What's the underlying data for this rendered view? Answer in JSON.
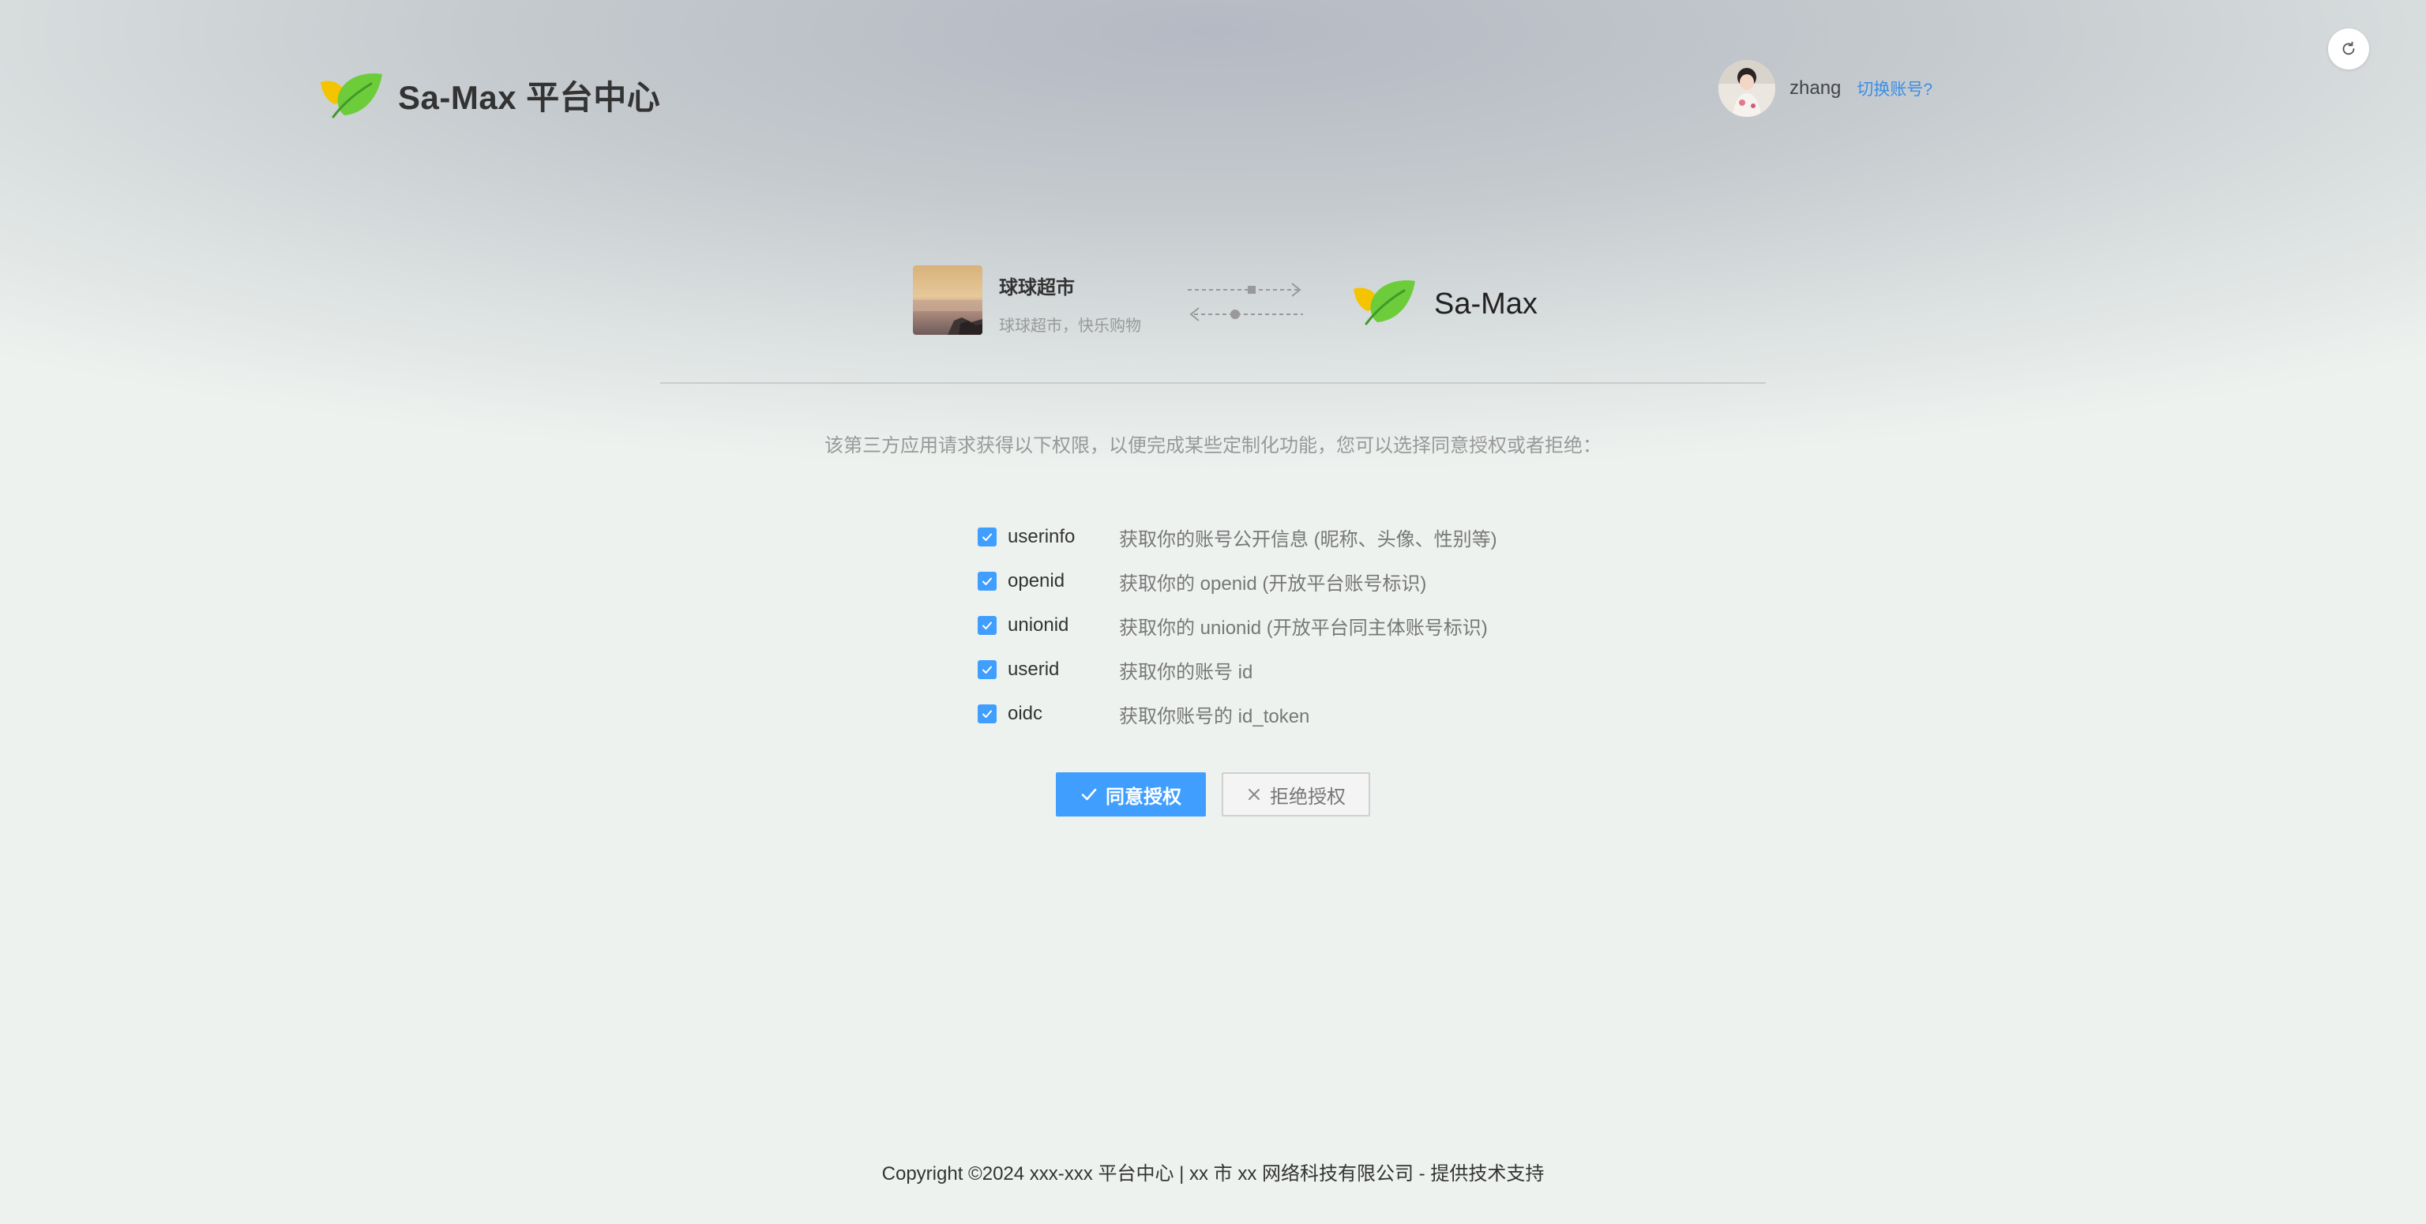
{
  "header": {
    "logo_icon": "leaf-logo-icon",
    "title": "Sa-Max 平台中心",
    "user": {
      "avatar": "user-avatar",
      "name": "zhang",
      "switch_label": "切换账号?"
    },
    "refresh_icon": "refresh-icon"
  },
  "connection": {
    "client_app": {
      "name": "球球超市",
      "description": "球球超市，快乐购物"
    },
    "arrows_icon": "exchange-arrows-icon",
    "platform": {
      "logo_icon": "leaf-logo-icon",
      "name": "Sa-Max"
    }
  },
  "prompt": "该第三方应用请求获得以下权限，以便完成某些定制化功能，您可以选择同意授权或者拒绝：",
  "scopes": [
    {
      "key": "userinfo",
      "description": "获取你的账号公开信息 (昵称、头像、性别等)",
      "checked": true
    },
    {
      "key": "openid",
      "description": "获取你的 openid (开放平台账号标识)",
      "checked": true
    },
    {
      "key": "unionid",
      "description": "获取你的 unionid (开放平台同主体账号标识)",
      "checked": true
    },
    {
      "key": "userid",
      "description": "获取你的账号 id",
      "checked": true
    },
    {
      "key": "oidc",
      "description": "获取你账号的 id_token",
      "checked": true
    }
  ],
  "actions": {
    "agree_label": "同意授权",
    "reject_label": "拒绝授权"
  },
  "footer": {
    "copyright": "Copyright ©2024 xxx-xxx 平台中心 | xx 市 xx 网络科技有限公司 - 提供技术支持"
  },
  "colors": {
    "primary": "#409eff",
    "leaf_green": "#6ccc3a",
    "leaf_yellow": "#f5c400"
  }
}
